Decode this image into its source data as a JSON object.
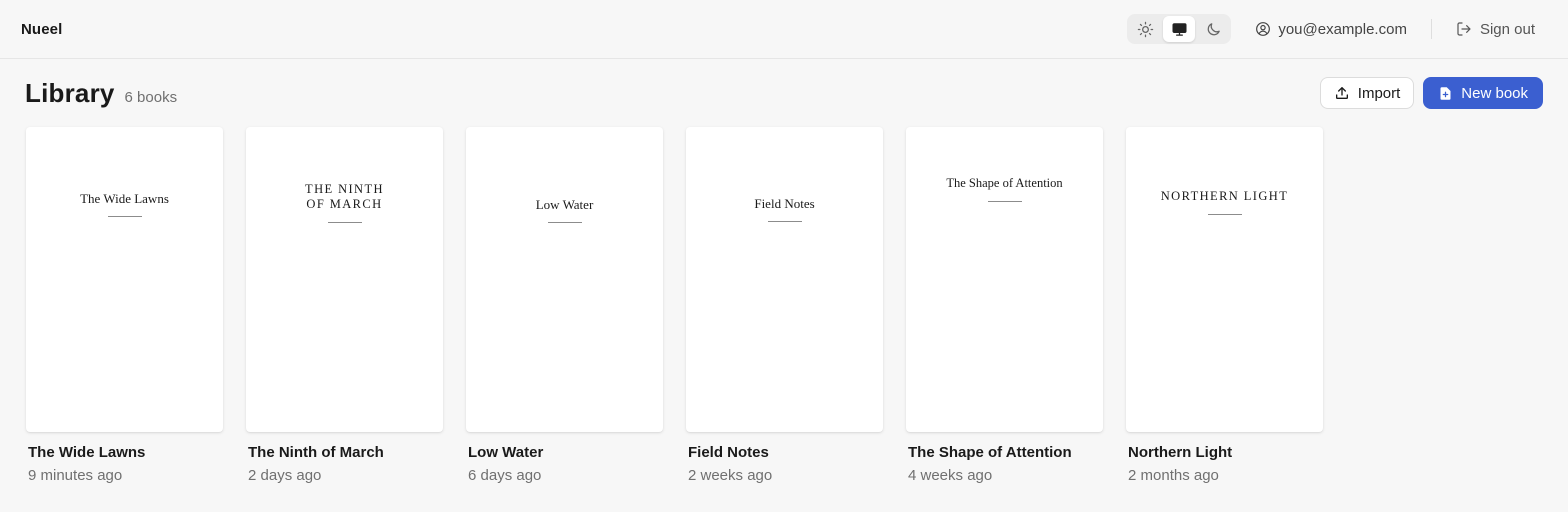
{
  "app": {
    "name": "Nueel"
  },
  "user": {
    "email": "you@example.com"
  },
  "nav": {
    "sign_out": "Sign out"
  },
  "theme": {
    "options": [
      "light",
      "system",
      "dark"
    ],
    "selected": "system"
  },
  "library": {
    "title": "Library",
    "count": "6 books",
    "import_label": "Import",
    "new_label": "New book"
  },
  "books": [
    {
      "cover_title": "The Wide Lawns",
      "name": "The Wide Lawns",
      "time": "9 minutes ago"
    },
    {
      "cover_title": "THE NINTH OF MARCH",
      "name": "The Ninth of March",
      "time": "2 days ago"
    },
    {
      "cover_title": "Low Water",
      "name": "Low Water",
      "time": "6 days ago"
    },
    {
      "cover_title": "Field Notes",
      "name": "Field Notes",
      "time": "2 weeks ago"
    },
    {
      "cover_title": "The Shape of Attention",
      "name": "The Shape of Attention",
      "time": "4 weeks ago"
    },
    {
      "cover_title": "NORTHERN LIGHT",
      "name": "Northern Light",
      "time": "2 months ago"
    }
  ],
  "colors": {
    "accent": "#3b5fd0",
    "background": "#f7f7f7"
  }
}
